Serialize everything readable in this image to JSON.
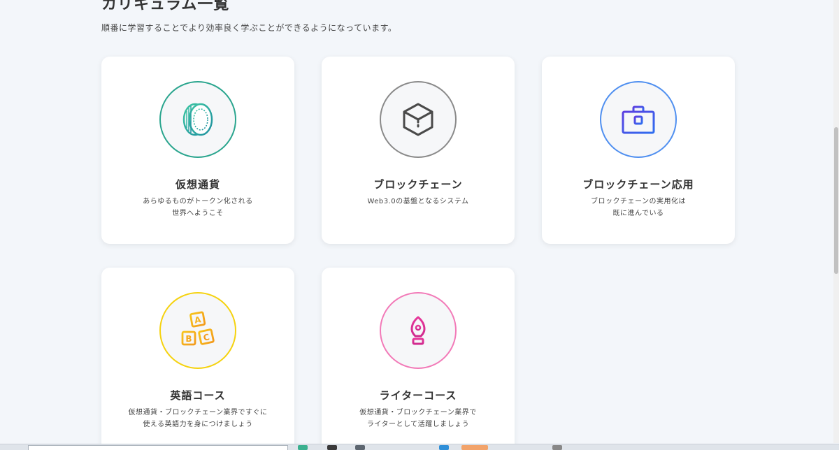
{
  "section": {
    "title": "カリキュラム一覧",
    "description": "順番に学習することでより効率良く学ぶことができるようになっています。"
  },
  "courses": [
    {
      "title": "仮想通貨",
      "desc_line1": "あらゆるものがトークン化される",
      "desc_line2": "世界へようこそ",
      "icon": "coin-icon",
      "color": "#2aa58e"
    },
    {
      "title": "ブロックチェーン",
      "desc_line1": "Web3.0の基盤となるシステム",
      "desc_line2": "",
      "icon": "cube-icon",
      "color": "#8a8a8a"
    },
    {
      "title": "ブロックチェーン応用",
      "desc_line1": "ブロックチェーンの実用化は",
      "desc_line2": "既に進んでいる",
      "icon": "briefcase-icon",
      "color": "#4f8ff0"
    },
    {
      "title": "英語コース",
      "desc_line1": "仮想通貨・ブロックチェーン業界ですぐに",
      "desc_line2": "使える英語力を身につけましょう",
      "icon": "abc-blocks-icon",
      "color": "#f5d20f"
    },
    {
      "title": "ライターコース",
      "desc_line1": "仮想通貨・ブロックチェーン業界で",
      "desc_line2": "ライターとして活躍しましょう",
      "icon": "fountain-pen-icon",
      "color": "#f27ab8"
    }
  ]
}
